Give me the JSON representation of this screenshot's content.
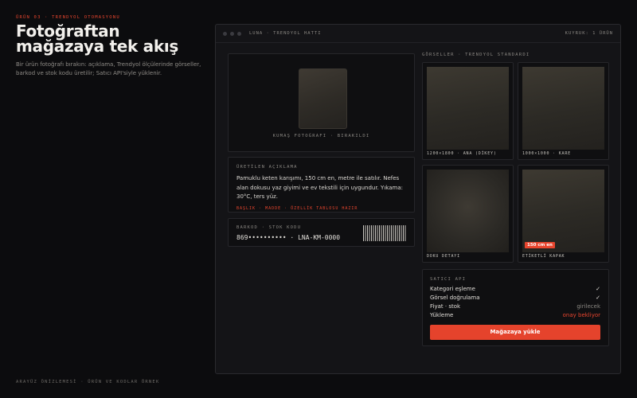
{
  "hero": {
    "eyebrow": "ÜRÜN 03 · TRENDYOL OTOMASYONU",
    "title": "Fotoğraftan mağazaya tek akış",
    "subtitle": "Bir ürün fotoğrafı bırakın: açıklama, Trendyol ölçülerinde görseller, barkod ve stok kodu üretilir; Satıcı API'siyle yüklenir.",
    "footer": "ARAYÜZ ÖNİZLEMESİ · ÜRÜN VE KODLAR ÖRNEK"
  },
  "window": {
    "title": "LUNA · TRENDYOL HATTI",
    "queue": "KUYRUK: 1 ÜRÜN"
  },
  "photo": {
    "caption": "KUMAŞ FOTOĞRAFI · BIRAKILDI"
  },
  "description": {
    "label": "ÜRETİLEN AÇIKLAMA",
    "text": "Pamuklu keten karışımı, 150 cm en, metre ile satılır. Nefes alan dokusu yaz giyimi ve ev tekstili için uygundur. Yıkama: 30°C, ters yüz.",
    "tags": "BAŞLIK · MADDE · ÖZELLİK TABLOSU HAZIR"
  },
  "barcode": {
    "label": "BARKOD · STOK KODU",
    "value": "869•••••••••• · LNA-KM-0000"
  },
  "images": {
    "label": "GÖRSELLER · TRENDYOL STANDARDI",
    "items": [
      {
        "caption": "1200×1800 · ANA (DİKEY)"
      },
      {
        "caption": "1000×1000 · KARE"
      },
      {
        "caption": "DOKU DETAYI"
      },
      {
        "caption": "ETİKETLİ KAPAK",
        "badge": "150 cm en"
      }
    ]
  },
  "api": {
    "label": "SATICI API",
    "rows": [
      {
        "label": "Kategori eşleme",
        "value": "✓",
        "color": "#e8e6e1"
      },
      {
        "label": "Görsel doğrulama",
        "value": "✓",
        "color": "#e8e6e1"
      },
      {
        "label": "Fiyat · stok",
        "value": "girilecek",
        "color": "#8a8782"
      },
      {
        "label": "Yükleme",
        "value": "onay bekliyor",
        "color": "#e8452e"
      }
    ],
    "button": "Mağazaya yükle"
  },
  "colors": {
    "accent": "#e8452e",
    "background": "#0c0c0e",
    "window": "#141417"
  }
}
